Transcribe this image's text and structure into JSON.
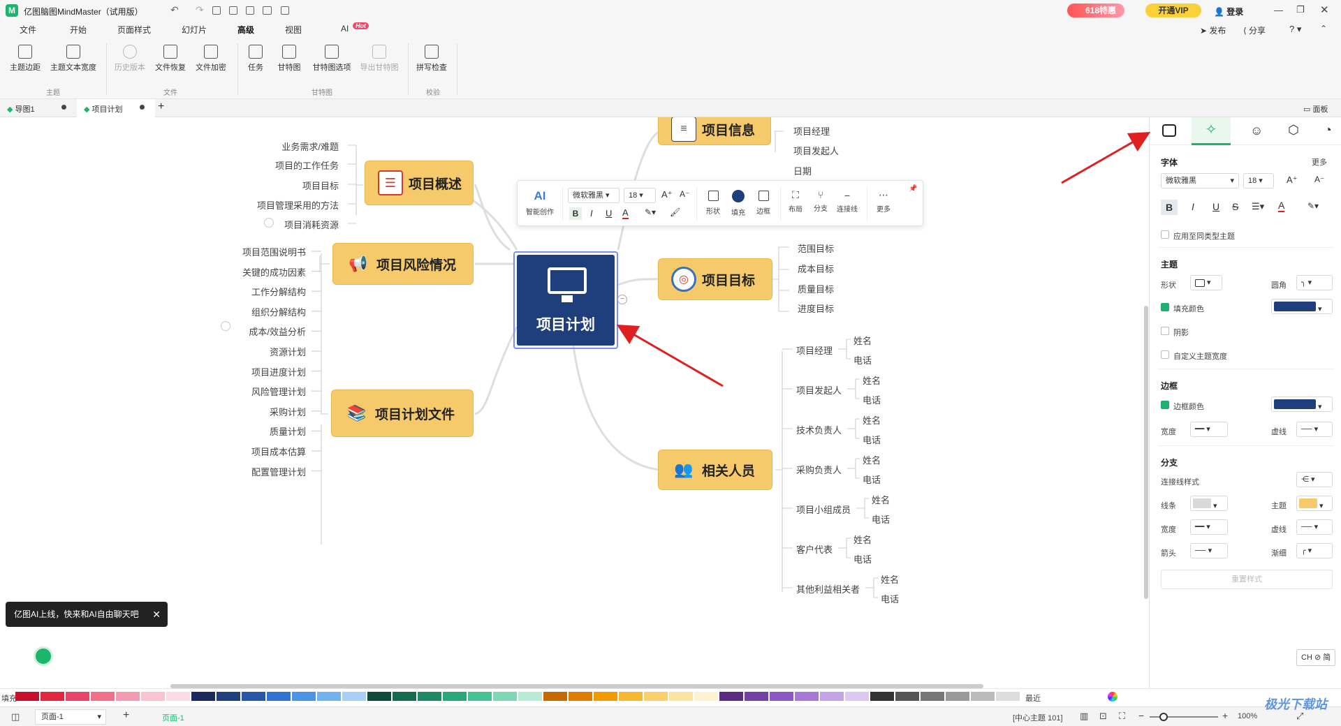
{
  "app": {
    "title": "亿图脑图MindMaster（试用版）",
    "promo_badge": "618特惠",
    "vip_button": "开通VIP",
    "login_button": "登录",
    "publish": "发布",
    "share": "分享",
    "help": "?"
  },
  "menu": [
    "文件",
    "开始",
    "页面样式",
    "幻灯片",
    "高级",
    "视图",
    "AI"
  ],
  "menu_hot_badge": "Hot",
  "ribbon": {
    "buttons": [
      {
        "label": "主题边距",
        "group": "主题",
        "disabled": false
      },
      {
        "label": "主题文本宽度",
        "group": "主题",
        "disabled": false
      },
      {
        "label": "历史版本",
        "group": "文件",
        "disabled": true
      },
      {
        "label": "文件恢复",
        "group": "文件",
        "disabled": false
      },
      {
        "label": "文件加密",
        "group": "文件",
        "disabled": false
      },
      {
        "label": "任务",
        "group": "甘特图",
        "disabled": false
      },
      {
        "label": "甘特图",
        "group": "甘特图",
        "disabled": false
      },
      {
        "label": "甘特图选项",
        "group": "甘特图",
        "disabled": false
      },
      {
        "label": "导出甘特图",
        "group": "甘特图",
        "disabled": true
      },
      {
        "label": "拼写检查",
        "group": "校验",
        "disabled": false
      }
    ],
    "groups": [
      "主题",
      "文件",
      "甘特图",
      "校验"
    ]
  },
  "tabs": [
    {
      "label": "导图1"
    },
    {
      "label": "项目计划"
    }
  ],
  "panel_toggle": "面板",
  "mindmap": {
    "center": "项目计划",
    "topics": {
      "overview": {
        "title": "项目概述",
        "leaves": [
          "业务需求/难题",
          "项目的工作任务",
          "项目目标",
          "项目管理采用的方法",
          "项目消耗资源"
        ]
      },
      "risk": {
        "title": "项目风险情况",
        "leaves": []
      },
      "docs": {
        "title": "项目计划文件",
        "leaves": [
          "项目范围说明书",
          "关键的成功因素",
          "工作分解结构",
          "组织分解结构",
          "成本/效益分析",
          "资源计划",
          "项目进度计划",
          "风险管理计划",
          "采购计划",
          "质量计划",
          "项目成本估算",
          "配置管理计划"
        ]
      },
      "info": {
        "title": "项目信息",
        "leaves": [
          "项目经理",
          "项目发起人",
          "日期"
        ]
      },
      "goal": {
        "title": "项目目标",
        "leaves": [
          "范围目标",
          "成本目标",
          "质量目标",
          "进度目标"
        ]
      },
      "people": {
        "title": "相关人员",
        "groups": [
          {
            "name": "项目经理",
            "items": [
              "姓名",
              "电话"
            ]
          },
          {
            "name": "项目发起人",
            "items": [
              "姓名",
              "电话"
            ]
          },
          {
            "name": "技术负责人",
            "items": [
              "姓名",
              "电话"
            ]
          },
          {
            "name": "采购负责人",
            "items": [
              "姓名",
              "电话"
            ]
          },
          {
            "name": "项目小组成员",
            "items": [
              "姓名",
              "电话"
            ]
          },
          {
            "name": "客户代表",
            "items": [
              "姓名",
              "电话"
            ]
          },
          {
            "name": "其他利益相关者",
            "items": [
              "姓名",
              "电话"
            ]
          }
        ]
      }
    }
  },
  "float_toolbar": {
    "ai_label": "AI",
    "ai_caption": "智能创作",
    "font": "微软雅黑",
    "size": "18",
    "shape": "形状",
    "fill": "填充",
    "border": "边框",
    "layout": "布局",
    "branch": "分支",
    "connector": "连接线",
    "more": "更多"
  },
  "ai_toast": "亿图AI上线，快来和AI自由聊天吧",
  "panel": {
    "font_title": "字体",
    "more": "更多",
    "font_value": "微软雅黑",
    "size_value": "18",
    "apply_same": "应用至同类型主题",
    "topic_title": "主题",
    "shape": "形状",
    "corner": "圆角",
    "fill_color": "填充颜色",
    "shadow": "阴影",
    "custom_width": "自定义主题宽度",
    "border_title": "边框",
    "border_color": "边框颜色",
    "width": "宽度",
    "dash": "虚线",
    "branch_title": "分支",
    "connector_style": "连接线样式",
    "line": "线条",
    "topic": "主题",
    "arrow": "箭头",
    "taper": "渐细",
    "reset": "重置样式",
    "fill_hex": "#1f3e7c",
    "border_hex": "#1f3e7c",
    "topic_hex": "#f6ca6b",
    "line_hex": "#cccccc"
  },
  "ime": "CH ⊘ 简",
  "colorbar": {
    "fill_label": "填充",
    "recent_label": "最近"
  },
  "status": {
    "page_tab": "页面-1",
    "page_active": "页面-1",
    "center_info": "[中心主题 101]",
    "zoom": "100%"
  },
  "watermark": "极光下载站"
}
